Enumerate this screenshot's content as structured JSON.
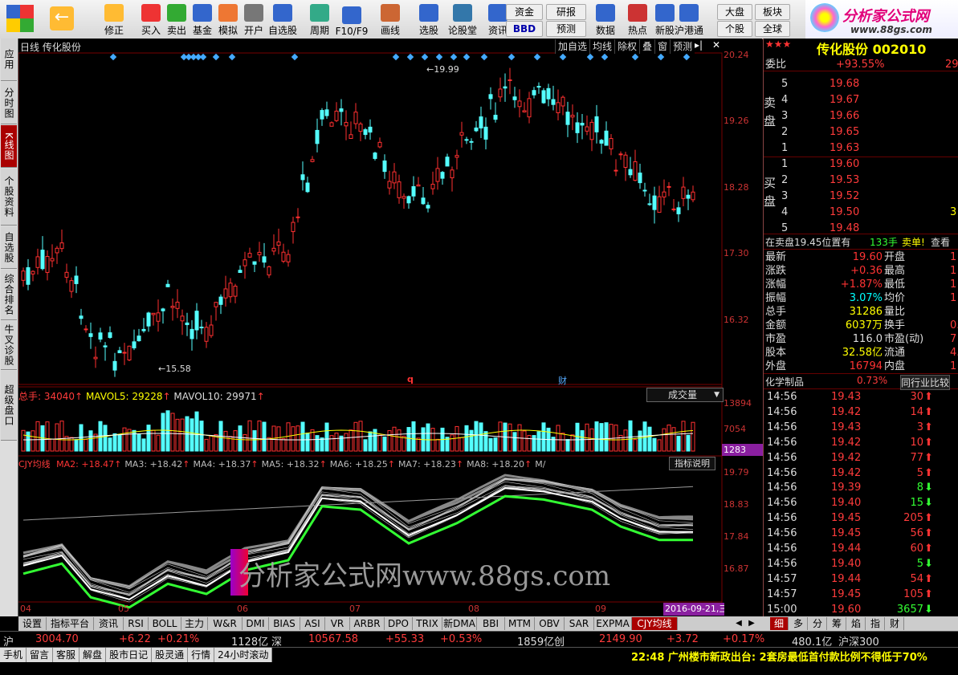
{
  "toolbar": {
    "buttons": [
      {
        "label": "修正",
        "icon": "back-arrow-icon"
      },
      {
        "label": "买入",
        "icon": "buy-icon"
      },
      {
        "label": "卖出",
        "icon": "sell-icon"
      },
      {
        "label": "基金",
        "icon": "fund-icon"
      },
      {
        "label": "模拟",
        "icon": "hammer-icon"
      },
      {
        "label": "开户",
        "icon": "lock-icon"
      },
      {
        "label": "自选股",
        "icon": "star-icon"
      },
      {
        "label": "周期",
        "icon": "clock-icon"
      },
      {
        "label": "F10/F9",
        "icon": "f10-icon"
      },
      {
        "label": "画线",
        "icon": "pencil-icon"
      },
      {
        "label": "选股",
        "icon": "chart-icon"
      },
      {
        "label": "论股堂",
        "icon": "talk-icon"
      },
      {
        "label": "资讯",
        "icon": "news-icon"
      },
      {
        "label": "数据",
        "icon": "pe-icon"
      },
      {
        "label": "热点",
        "icon": "hotspot-icon"
      },
      {
        "label": "新股",
        "icon": "ipo-icon"
      },
      {
        "label": "沪港通",
        "icon": "hk-icon"
      }
    ],
    "small": {
      "zijin": "资金",
      "bbd": "BBD",
      "yanbao": "研报",
      "yuce": "预测",
      "dapan": "大盘",
      "bankuai": "板块",
      "gegu": "个股",
      "quanqiu": "全球"
    }
  },
  "logo": {
    "title": "分析家公式网",
    "url": "www.88gs.com"
  },
  "left_tabs": [
    "应用",
    "分时图",
    "K线图",
    "个股资料",
    "自选股",
    "综合排名",
    "牛叉诊股",
    "超级盘口"
  ],
  "left_tab_active": 2,
  "chart": {
    "header_left": "日线  传化股份",
    "header_buttons": [
      "加自选",
      "均线",
      "除权",
      "叠",
      "窗",
      "预测"
    ],
    "price_axis": [
      "20.24",
      "19.26",
      "18.28",
      "17.30",
      "16.32"
    ],
    "high_label": "19.99",
    "low_label": "15.58",
    "event_q": "q",
    "event_cai": "财",
    "vol_header": {
      "label": "总手: 34040",
      "ma5": "MAVOL5: 29228",
      "ma10": "MAVOL10: 29971"
    },
    "vol_dropdown": "成交量",
    "vol_axis": [
      "13894",
      "7054"
    ],
    "vol_current": "1283",
    "ind_header": {
      "name": "CJY均线",
      "items": [
        "MA2: +18.47",
        "MA3: +18.42",
        "MA4: +18.37",
        "MA5: +18.32",
        "MA6: +18.25",
        "MA7: +18.23",
        "MA8: +18.20",
        "M/"
      ]
    },
    "ind_button": "指标说明",
    "ind_axis": [
      "19.79",
      "18.83",
      "17.84",
      "16.87"
    ],
    "x_axis": [
      "04",
      "05",
      "06",
      "07",
      "08",
      "09"
    ],
    "date_label": "2016-09-21,三",
    "cjy_label": "CJY均线",
    "watermark": "分析家公式网www.88gs.com"
  },
  "quote": {
    "title": "传化股份 002010",
    "weibi_label": "委比",
    "weibi_value": "+93.55%",
    "weibi_diff": "29",
    "sell": [
      {
        "n": "5",
        "p": "19.68"
      },
      {
        "n": "4",
        "p": "19.67"
      },
      {
        "n": "3",
        "p": "19.66"
      },
      {
        "n": "2",
        "p": "19.65"
      },
      {
        "n": "1",
        "p": "19.63"
      }
    ],
    "buy": [
      {
        "n": "1",
        "p": "19.60"
      },
      {
        "n": "2",
        "p": "19.53"
      },
      {
        "n": "3",
        "p": "19.52"
      },
      {
        "n": "4",
        "p": "19.50",
        "v": "3"
      },
      {
        "n": "5",
        "p": "19.48"
      }
    ],
    "sell_label": "卖盘",
    "buy_label": "买盘",
    "position_line": "在卖盘19.45位置有",
    "position_hands": "133手",
    "sell_single": "卖单!",
    "check": "查看",
    "stats_left": [
      [
        "最新",
        "19.60"
      ],
      [
        "涨跌",
        "+0.36"
      ],
      [
        "涨幅",
        "+1.87%"
      ],
      [
        "振幅",
        "3.07%"
      ],
      [
        "总手",
        "31286"
      ],
      [
        "金额",
        "6037万"
      ],
      [
        "市盈",
        "116.0"
      ],
      [
        "股本",
        "32.58亿"
      ],
      [
        "外盘",
        "16794"
      ]
    ],
    "stats_right": [
      [
        "开盘",
        "1"
      ],
      [
        "最高",
        "1"
      ],
      [
        "最低",
        "1"
      ],
      [
        "均价",
        "1"
      ],
      [
        "量比",
        ""
      ],
      [
        "换手",
        "0."
      ],
      [
        "市盈(动)",
        "7"
      ],
      [
        "流通",
        "4."
      ],
      [
        "内盘",
        "1"
      ]
    ],
    "industry": "化学制品",
    "industry_pct": "0.73%",
    "industry_rank": "同行业比较",
    "ticks": [
      [
        "14:56",
        "19.43",
        "30",
        "up"
      ],
      [
        "14:56",
        "19.42",
        "14",
        "up"
      ],
      [
        "14:56",
        "19.43",
        "3",
        "up"
      ],
      [
        "14:56",
        "19.42",
        "10",
        "up"
      ],
      [
        "14:56",
        "19.42",
        "77",
        "up"
      ],
      [
        "14:56",
        "19.42",
        "5",
        "up"
      ],
      [
        "14:56",
        "19.39",
        "8",
        "dn"
      ],
      [
        "14:56",
        "19.40",
        "15",
        "dn"
      ],
      [
        "14:56",
        "19.45",
        "205",
        "up"
      ],
      [
        "14:56",
        "19.45",
        "56",
        "up"
      ],
      [
        "14:56",
        "19.44",
        "60",
        "up"
      ],
      [
        "14:56",
        "19.40",
        "5",
        "dn"
      ],
      [
        "14:57",
        "19.44",
        "54",
        "up"
      ],
      [
        "14:57",
        "19.45",
        "105",
        "up"
      ],
      [
        "15:00",
        "19.60",
        "3657",
        "dn"
      ]
    ],
    "bottom_tabs": [
      "细",
      "多",
      "分",
      "筹",
      "焰",
      "指",
      "财"
    ]
  },
  "bottom_tabs": [
    "设置",
    "指标平台",
    "资讯",
    "RSI",
    "BOLL",
    "主力",
    "W&R",
    "DMI",
    "BIAS",
    "ASI",
    "VR",
    "ARBR",
    "DPO",
    "TRIX",
    "新DMA",
    "BBI",
    "MTM",
    "OBV",
    "SAR",
    "EXPMA",
    "CJY均线"
  ],
  "status": {
    "sh_label": "沪",
    "sh_val": "3004.70",
    "sh_chg": "+6.22",
    "sh_pct": "+0.21%",
    "sh_amt": "1128亿",
    "sz_label": "深",
    "sz_val": "10567.58",
    "sz_chg": "+55.33",
    "sz_pct": "+0.53%",
    "sz_amt": "1859亿",
    "cy_label": "创",
    "cy_val": "2149.90",
    "cy_chg": "+3.72",
    "cy_pct": "+0.17%",
    "cy_amt": "480.1亿",
    "hs300": "沪深300",
    "menu": [
      "手机",
      "留言",
      "客服",
      "解盘",
      "股市日记",
      "股灵通",
      "行情",
      "24小时滚动"
    ],
    "news": "22:48 广州楼市新政出台: 2套房最低首付款比例不得低于70%"
  }
}
